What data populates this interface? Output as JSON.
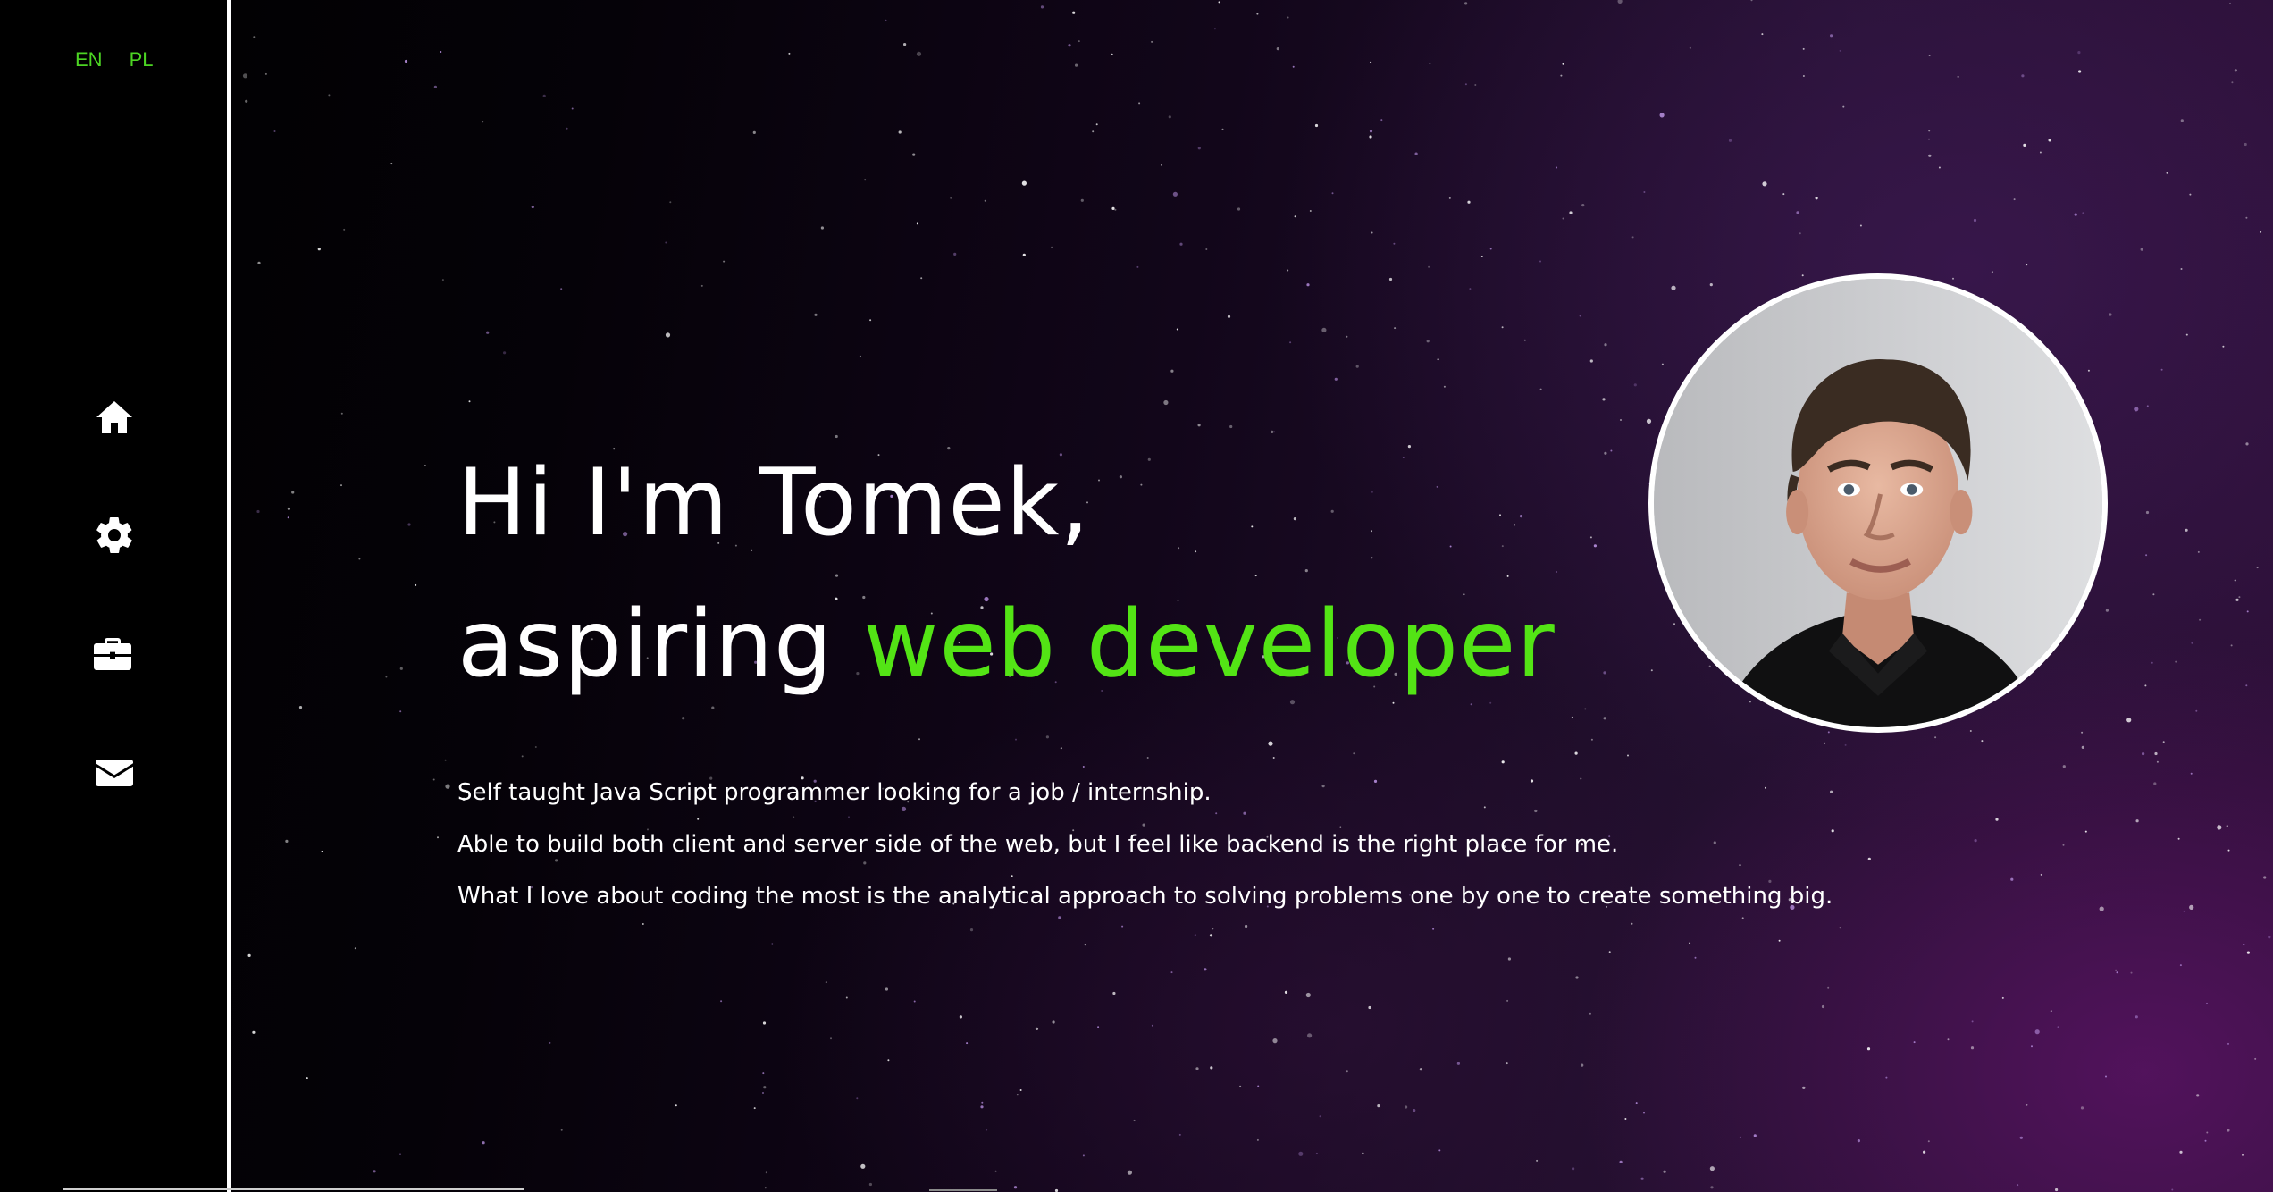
{
  "language_switcher": {
    "items": [
      {
        "label": "EN"
      },
      {
        "label": "PL"
      }
    ]
  },
  "sidebar": {
    "nav": [
      {
        "icon": "home-icon"
      },
      {
        "icon": "gear-icon"
      },
      {
        "icon": "briefcase-icon"
      },
      {
        "icon": "envelope-icon"
      }
    ]
  },
  "hero": {
    "line1": "Hi I'm Tomek,",
    "line2_prefix": "aspiring ",
    "line2_accent": "web developer"
  },
  "about": {
    "paragraphs": [
      "Self taught Java Script programmer looking for a job / internship.",
      "Able to build both client and server side of the web, but I feel like backend is the right place for me.",
      "What I love about coding the most is the analytical approach to solving problems one by one to create something big."
    ]
  },
  "colors": {
    "accent": "#53e415",
    "language": "#4cd423",
    "text": "#ffffff",
    "sidebar": "#000000",
    "background_tint": "#2c0f36"
  }
}
